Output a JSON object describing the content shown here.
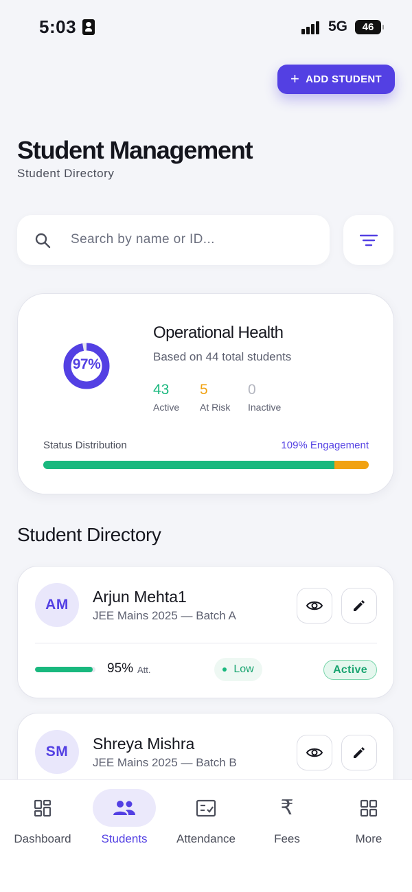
{
  "status_bar": {
    "time": "5:03",
    "network": "5G",
    "battery": "46"
  },
  "header": {
    "add_button_label": "ADD STUDENT",
    "title": "Student Management",
    "subtitle": "Student Directory"
  },
  "search": {
    "placeholder": "Search by name or ID...",
    "value": ""
  },
  "health": {
    "percent_label": "97%",
    "percent_value": 97,
    "title": "Operational Health",
    "subtitle": "Based on 44 total students",
    "stats": [
      {
        "value": "43",
        "label": "Active",
        "color": "#19b87e"
      },
      {
        "value": "5",
        "label": "At Risk",
        "color": "#f1a212"
      },
      {
        "value": "0",
        "label": "Inactive",
        "color": "#b4b6c0"
      }
    ],
    "distribution_label": "Status Distribution",
    "engagement_label": "109% Engagement",
    "distribution": {
      "active_fraction": 0.895,
      "at_risk_fraction": 0.105
    }
  },
  "directory": {
    "title": "Student Directory",
    "students": [
      {
        "initials": "AM",
        "name": "Arjun Mehta1",
        "batch": "JEE Mains 2025 — Batch A",
        "attendance": "95%",
        "attendance_unit": "Att.",
        "attendance_value": 95,
        "risk": "Low",
        "status": "Active"
      },
      {
        "initials": "SM",
        "name": "Shreya Mishra",
        "batch": "JEE Mains 2025 — Batch B"
      }
    ]
  },
  "nav": {
    "items": [
      {
        "label": "Dashboard",
        "icon": "dashboard-icon"
      },
      {
        "label": "Students",
        "icon": "students-icon",
        "active": true
      },
      {
        "label": "Attendance",
        "icon": "attendance-icon"
      },
      {
        "label": "Fees",
        "icon": "rupee-icon"
      },
      {
        "label": "More",
        "icon": "grid-icon"
      }
    ]
  },
  "colors": {
    "primary": "#5340e3",
    "success": "#19b87e",
    "warning": "#f1a212",
    "background": "#f4f5f9"
  }
}
